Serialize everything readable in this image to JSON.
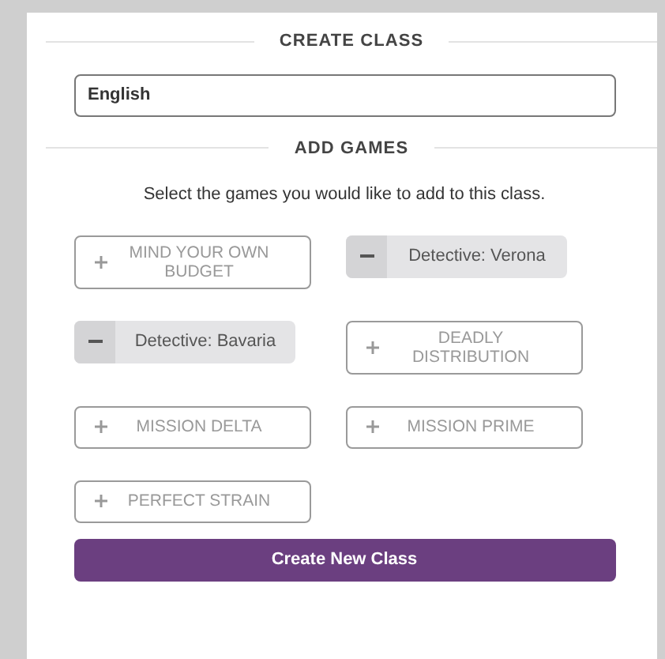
{
  "create_heading": "CREATE CLASS",
  "class_name": {
    "value": "English"
  },
  "games_heading": "ADD GAMES",
  "instructions": "Select the games you would like to add to this class.",
  "games": [
    {
      "label": "MIND YOUR OWN BUDGET",
      "selected": false
    },
    {
      "label": "Detective: Verona",
      "selected": true
    },
    {
      "label": "Detective: Bavaria",
      "selected": true
    },
    {
      "label": "DEADLY DISTRIBUTION",
      "selected": false
    },
    {
      "label": "MISSION DELTA",
      "selected": false
    },
    {
      "label": "MISSION PRIME",
      "selected": false
    },
    {
      "label": "PERFECT STRAIN",
      "selected": false
    }
  ],
  "submit_button": "Create New Class"
}
